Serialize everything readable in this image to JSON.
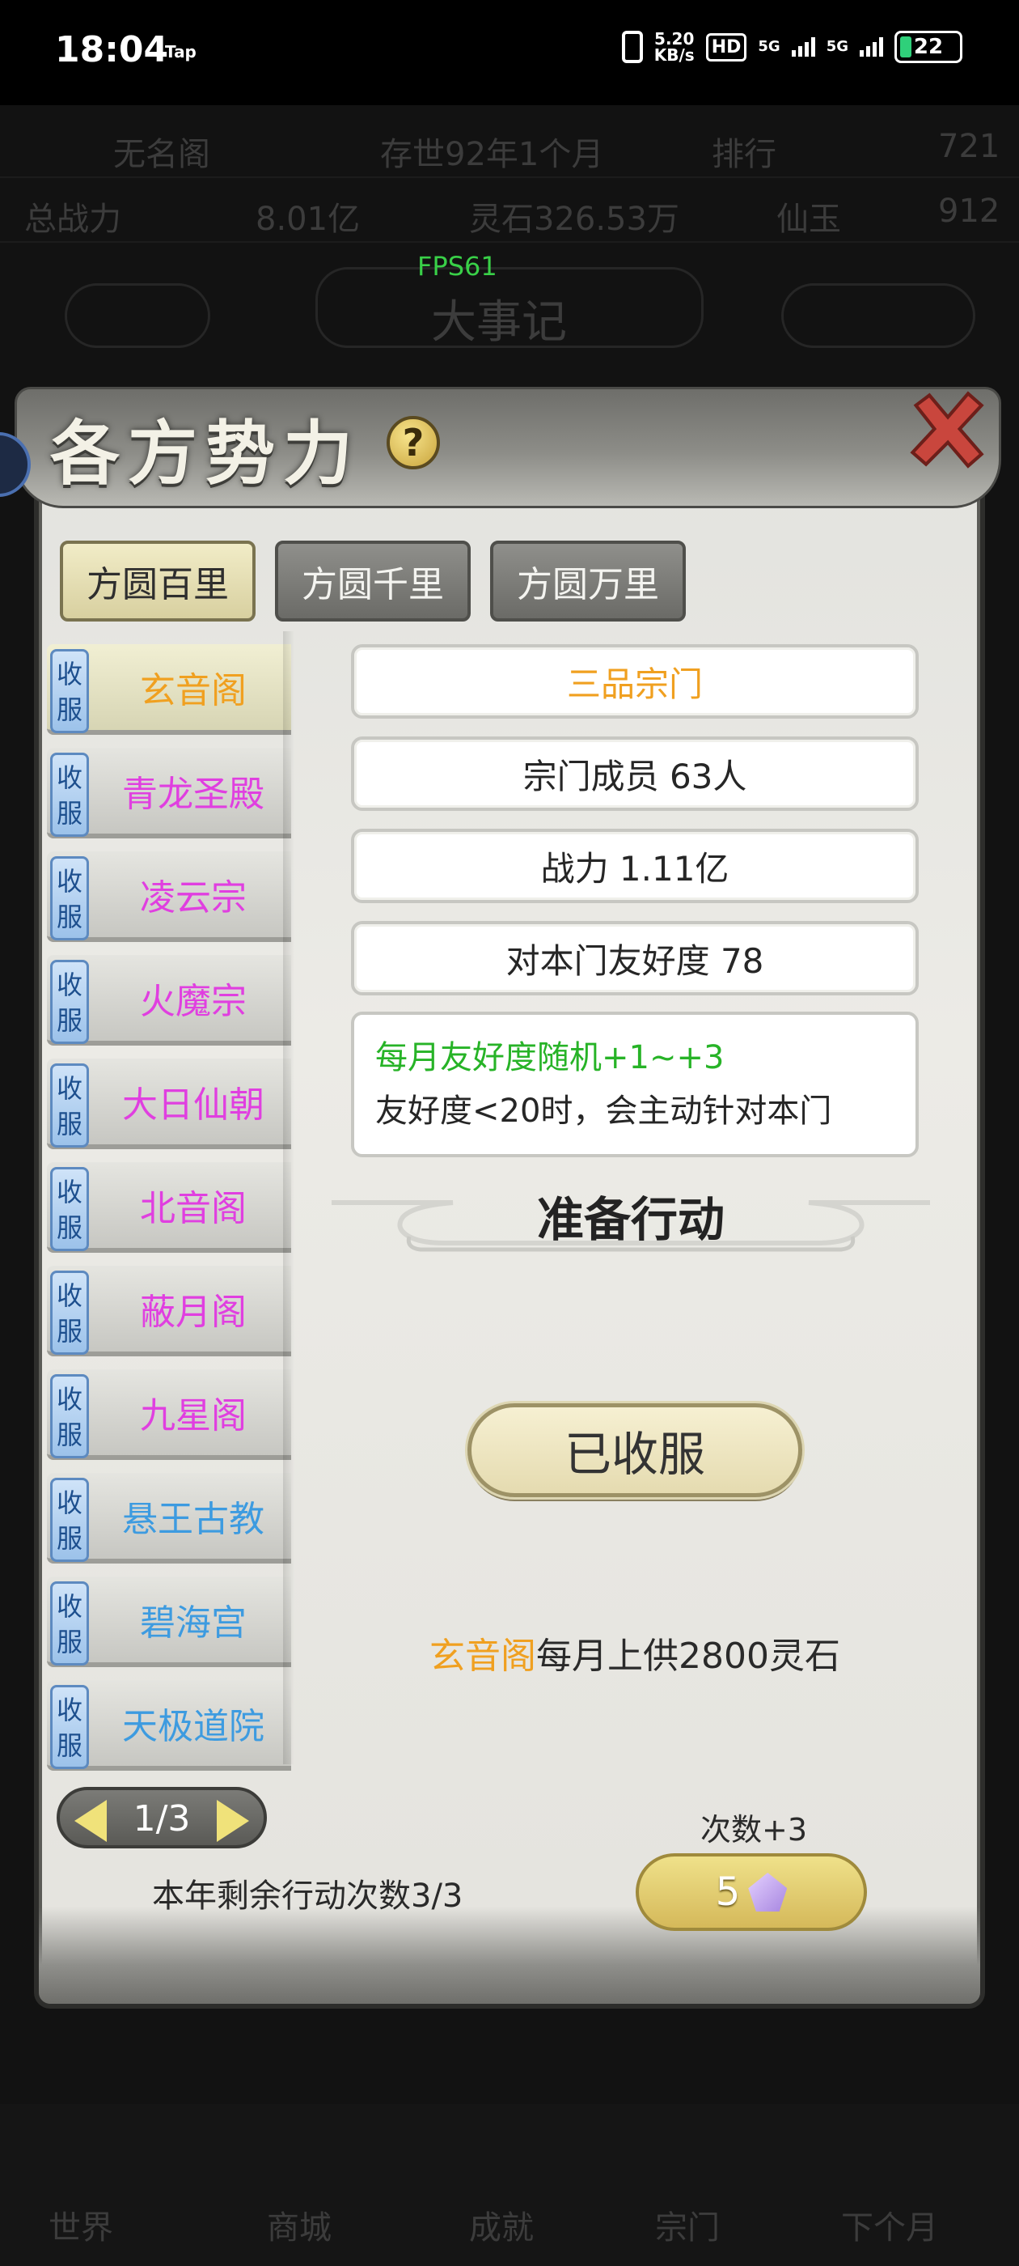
{
  "status_bar": {
    "time": "18:04",
    "tap_label": "Tap",
    "speed_value": "5.20",
    "speed_unit": "KB/s",
    "hd": "HD",
    "net1": "5G",
    "net2": "5G",
    "battery": "22"
  },
  "fps": "FPS61",
  "background": {
    "row1_left": "无名阁",
    "row1_mid": "存世92年1个月",
    "row1_right": "排行",
    "row1_num": "721",
    "row2_left": "总战力",
    "row2_mid": "8.01亿",
    "row2_mid2": "灵石326.53万",
    "row2_right": "仙玉",
    "row2_num": "912",
    "row3_center": "大事记",
    "bottom_labels": [
      "世界",
      "商城",
      "成就",
      "宗门",
      "下个月"
    ]
  },
  "dialog": {
    "title": "各方势力",
    "help_icon": "question-mark",
    "tabs": [
      {
        "label": "方圆百里",
        "active": true
      },
      {
        "label": "方圆千里",
        "active": false
      },
      {
        "label": "方圆万里",
        "active": false
      }
    ],
    "factions": [
      {
        "tag": "收服",
        "name": "玄音阁",
        "color": "#f0a020",
        "selected": true
      },
      {
        "tag": "收服",
        "name": "青龙圣殿",
        "color": "#e03fe0"
      },
      {
        "tag": "收服",
        "name": "凌云宗",
        "color": "#e03fe0"
      },
      {
        "tag": "收服",
        "name": "火魔宗",
        "color": "#e03fe0"
      },
      {
        "tag": "收服",
        "name": "大日仙朝",
        "color": "#e03fe0"
      },
      {
        "tag": "收服",
        "name": "北音阁",
        "color": "#e03fe0"
      },
      {
        "tag": "收服",
        "name": "蔽月阁",
        "color": "#e03fe0"
      },
      {
        "tag": "收服",
        "name": "九星阁",
        "color": "#e03fe0"
      },
      {
        "tag": "收服",
        "name": "悬王古教",
        "color": "#3d9be0"
      },
      {
        "tag": "收服",
        "name": "碧海宫",
        "color": "#3d9be0"
      },
      {
        "tag": "收服",
        "name": "天极道院",
        "color": "#3d9be0"
      }
    ],
    "info": {
      "rank": "三品宗门",
      "members": "宗门成员 63人",
      "power": "战力 1.11亿",
      "friendship": "对本门友好度 78",
      "desc_line1": "每月友好度随机+1~+3",
      "desc_line2": "友好度<20时，会主动针对本门"
    },
    "action_title": "准备行动",
    "action_button": "已收服",
    "tribute_name": "玄音阁",
    "tribute_text": "每月上供2800灵石",
    "pager": "1/3",
    "remaining": "本年剩余行动次数3/3",
    "count_label": "次数+3",
    "cost_value": "5",
    "colors": {
      "accent_gold": "#f0a020",
      "purple": "#e03fe0",
      "blue": "#3d9be0",
      "green": "#27b327"
    }
  }
}
